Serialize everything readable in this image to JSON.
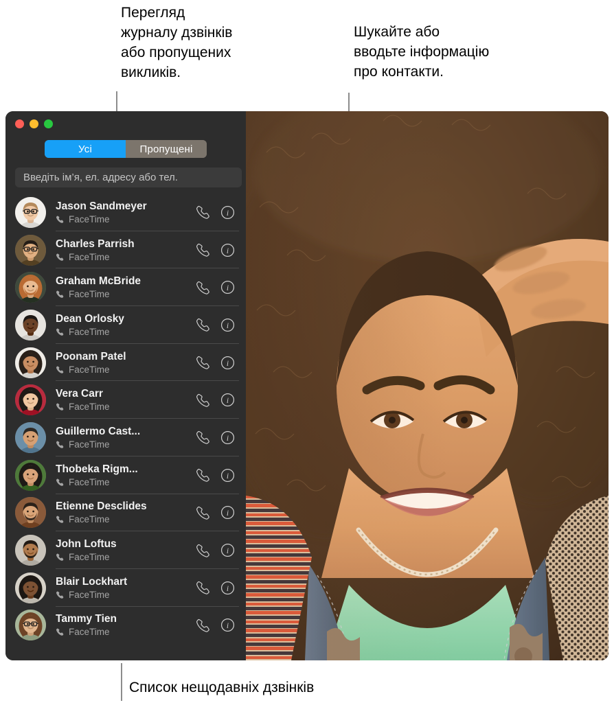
{
  "callouts": {
    "left": "Перегляд\nжурналу дзвінків\nабо пропущених\nвикликів.",
    "right": "Шукайте або\nвводьте інформацію\nпро контакти.",
    "bottom": "Список нещодавніх дзвінків"
  },
  "window": {
    "traffic_lights": {
      "close_color": "#ff5f57",
      "minimize_color": "#ffbd2e",
      "maximize_color": "#28c840"
    },
    "accent_color": "#17a0f7",
    "background_color": "#2d2d2d"
  },
  "segmented_control": {
    "options": [
      "Усі",
      "Пропущені"
    ],
    "selected": "Усі"
  },
  "search": {
    "value": "",
    "placeholder": "Введіть ім’я, ел. адресу або тел."
  },
  "call_list": {
    "rows": [
      {
        "name": "Jason Sandmeyer",
        "service": "FaceTime",
        "avatar": "avatar-jason"
      },
      {
        "name": "Charles Parrish",
        "service": "FaceTime",
        "avatar": "avatar-charles"
      },
      {
        "name": "Graham McBride",
        "service": "FaceTime",
        "avatar": "avatar-graham"
      },
      {
        "name": "Dean Orlosky",
        "service": "FaceTime",
        "avatar": "avatar-dean"
      },
      {
        "name": "Poonam Patel",
        "service": "FaceTime",
        "avatar": "avatar-poonam"
      },
      {
        "name": "Vera Carr",
        "service": "FaceTime",
        "avatar": "avatar-vera"
      },
      {
        "name": "Guillermo Cast...",
        "service": "FaceTime",
        "avatar": "avatar-guillermo"
      },
      {
        "name": "Thobeka Rigm...",
        "service": "FaceTime",
        "avatar": "avatar-thobeka"
      },
      {
        "name": "Etienne Desclides",
        "service": "FaceTime",
        "avatar": "avatar-etienne"
      },
      {
        "name": "John Loftus",
        "service": "FaceTime",
        "avatar": "avatar-john"
      },
      {
        "name": "Blair Lockhart",
        "service": "FaceTime",
        "avatar": "avatar-blair"
      },
      {
        "name": "Tammy Tien",
        "service": "FaceTime",
        "avatar": "avatar-tammy"
      }
    ],
    "call_icon": "phone-handset-icon",
    "info_icon": "info-circle-icon"
  },
  "photo_panel": {
    "description": "portrait-photo"
  }
}
